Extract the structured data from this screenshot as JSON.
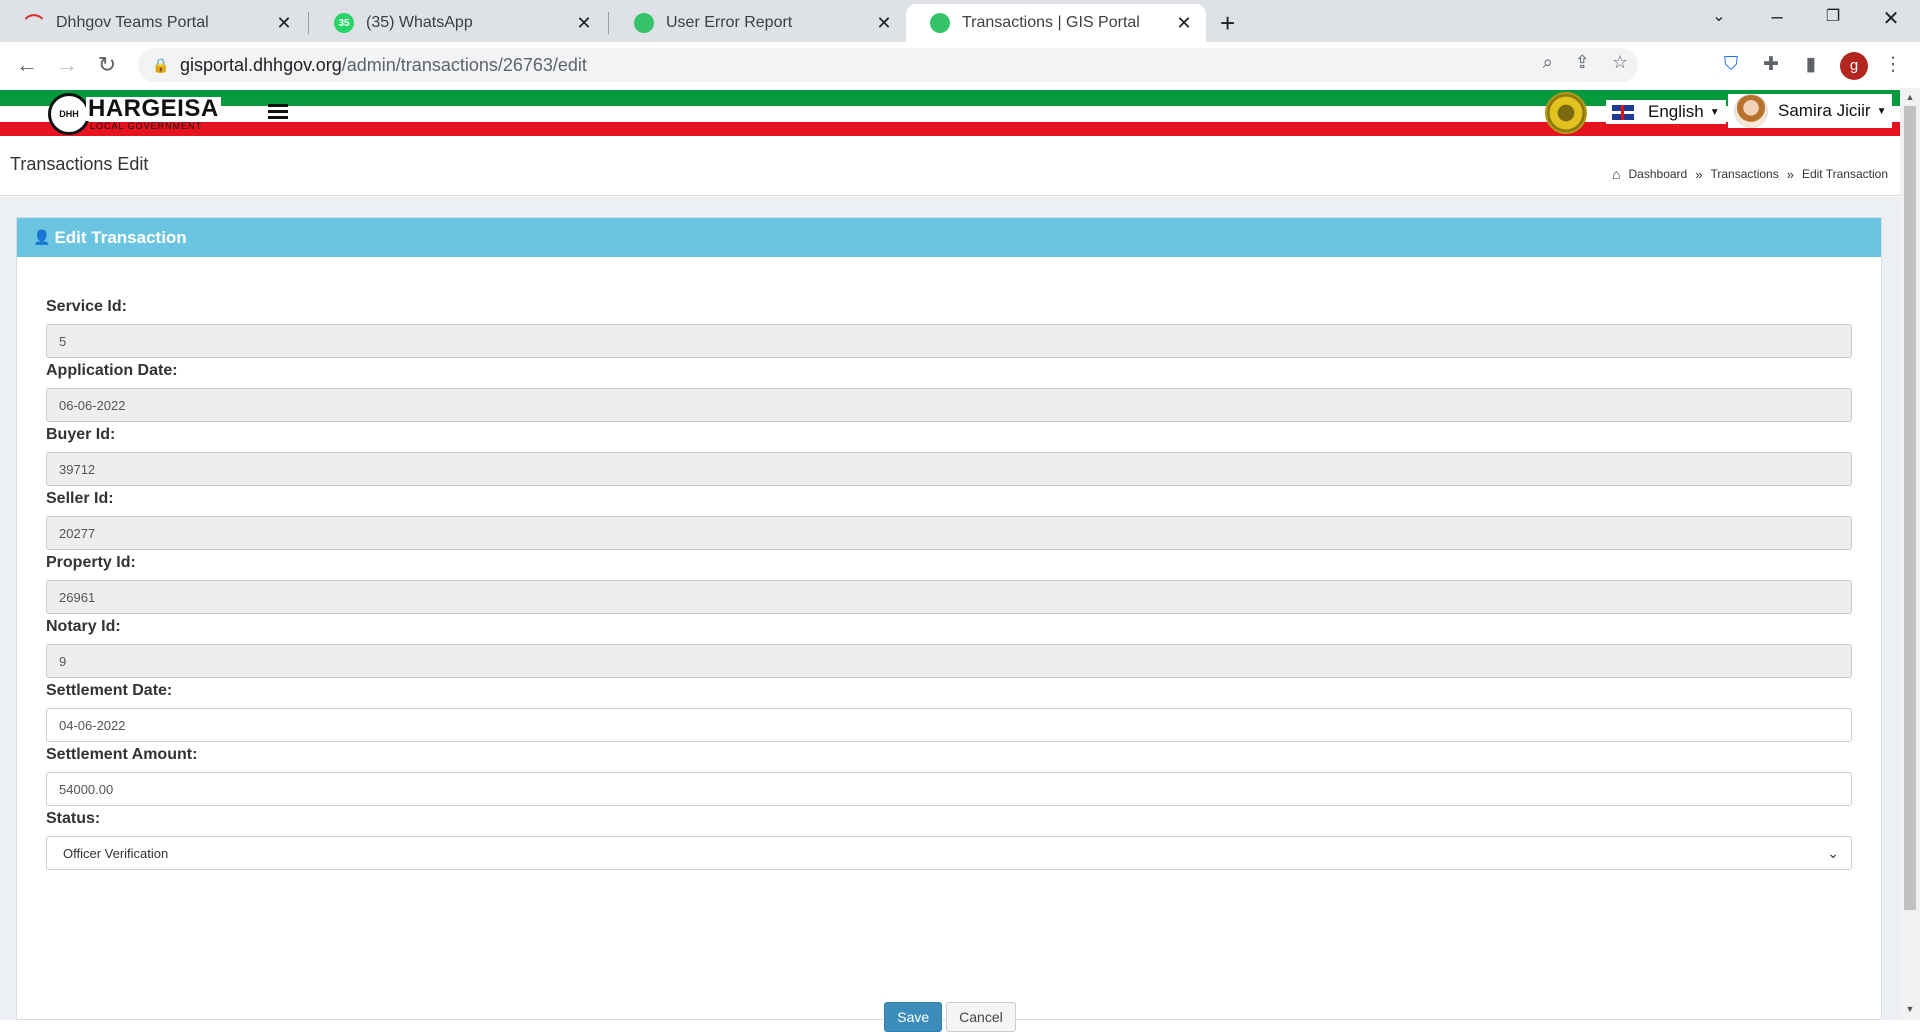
{
  "browser": {
    "tabs": [
      {
        "title": "Dhhgov Teams Portal",
        "close": "✕"
      },
      {
        "title": "(35) WhatsApp",
        "badge": "35",
        "close": "✕"
      },
      {
        "title": "User Error Report",
        "close": "✕"
      },
      {
        "title": "Transactions | GIS Portal",
        "close": "✕"
      }
    ],
    "new_tab": "+",
    "url_host": "gisportal.dhhgov.org",
    "url_path": "/admin/transactions/26763/edit",
    "profile_initial": "g"
  },
  "app": {
    "logo_text": "HARGEISA",
    "logo_sub": "LOCAL GOVERNMENT",
    "logo_badge": "DHH",
    "language": "English",
    "user_name": "Samira Jiciir"
  },
  "page": {
    "title": "Transactions Edit",
    "breadcrumb": [
      "Dashboard",
      "Transactions",
      "Edit Transaction"
    ],
    "breadcrumb_sep": "»"
  },
  "form": {
    "header": "Edit Transaction",
    "fields": [
      {
        "label": "Service Id:",
        "value": "5"
      },
      {
        "label": "Application Date:",
        "value": "06-06-2022"
      },
      {
        "label": "Buyer Id:",
        "value": "39712"
      },
      {
        "label": "Seller Id:",
        "value": "20277"
      },
      {
        "label": "Property Id:",
        "value": "26961"
      },
      {
        "label": "Notary Id:",
        "value": "9"
      },
      {
        "label": "Settlement Date:",
        "value": "04-06-2022"
      },
      {
        "label": "Settlement Amount:",
        "value": "54000.00"
      },
      {
        "label": "Status:",
        "value": "Officer Verification"
      }
    ],
    "save_label": "Save",
    "cancel_label": "Cancel"
  },
  "colors": {
    "header_blue": "#6bc4e0",
    "flag_green": "#079a3d",
    "flag_red": "#e5131f",
    "save_blue": "#3c8dbc"
  }
}
